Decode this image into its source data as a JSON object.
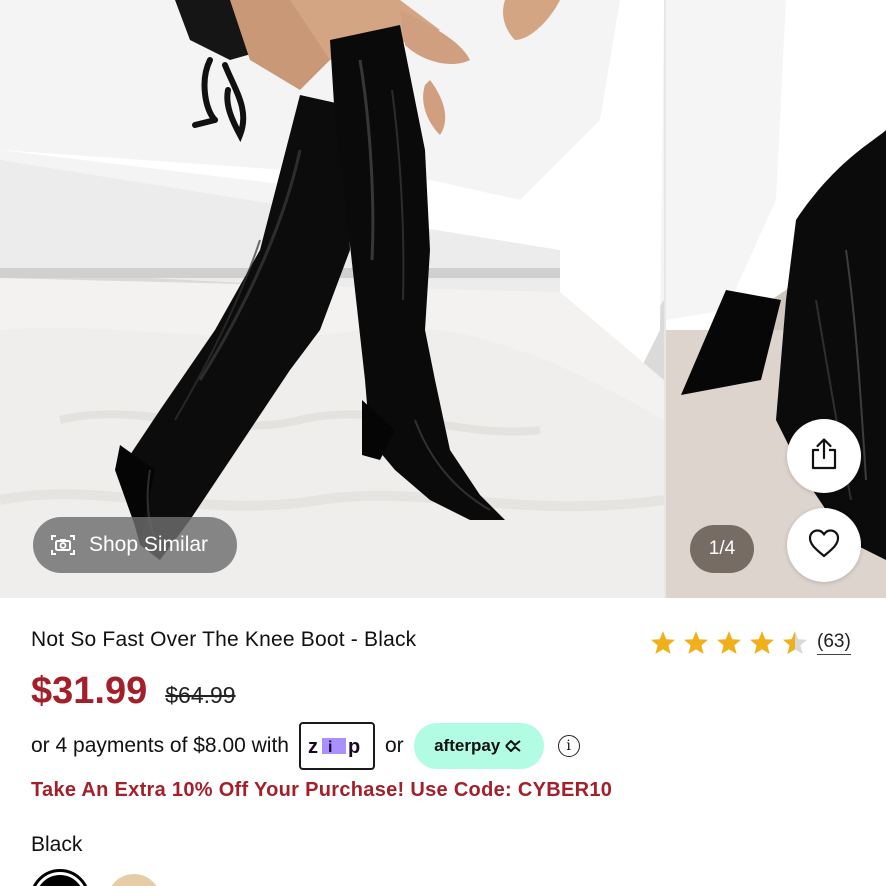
{
  "gallery": {
    "shop_similar_label": "Shop Similar",
    "counter": "1/4",
    "icons": [
      "camera-scan-icon",
      "share-icon",
      "heart-icon"
    ]
  },
  "product": {
    "title": "Not So Fast Over The Knee Boot - Black",
    "rating_value": 4.5,
    "rating_max": 5,
    "review_count": "(63)",
    "price": "$31.99",
    "original_price": "$64.99"
  },
  "payment": {
    "installment_text": "or 4 payments of $8.00 with",
    "zip_label": "zip",
    "or_text": "or",
    "afterpay_label": "afterpay"
  },
  "promo_text": "Take An Extra 10% Off Your Purchase! Use Code: CYBER10",
  "color": {
    "selected": "Black",
    "swatches": [
      {
        "name": "Black",
        "hex": "#000000"
      },
      {
        "name": "Nude",
        "hex": "#e6cda8"
      }
    ]
  },
  "colors": {
    "price_red": "#a3202a",
    "star_gold": "#f0b01c",
    "afterpay_mint": "#b2fce4"
  }
}
